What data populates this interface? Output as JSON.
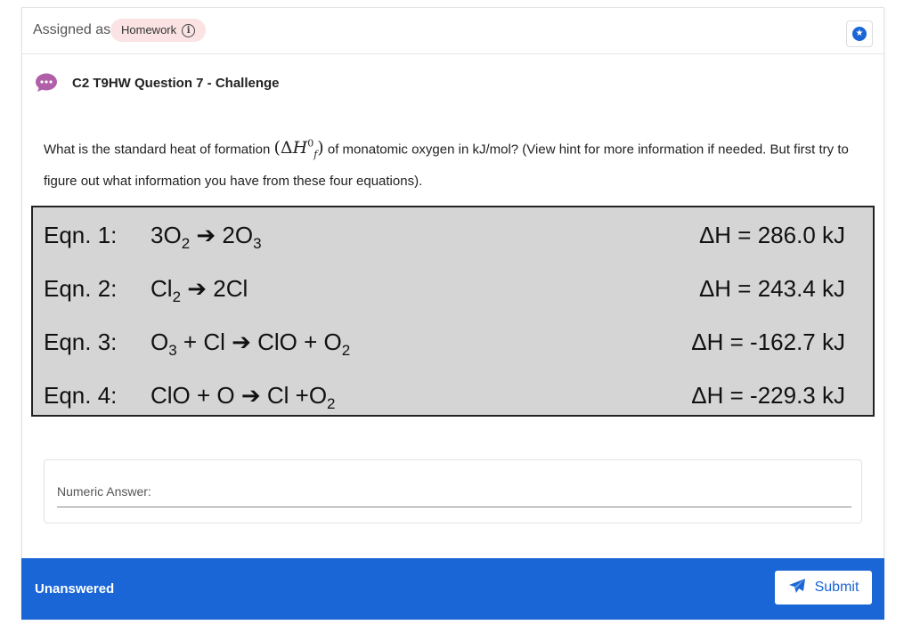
{
  "header": {
    "assigned_label": "Assigned as",
    "badge_label": "Homework"
  },
  "question": {
    "title": "C2 T9HW Question 7 - Challenge",
    "text_before": "What is the standard heat of formation",
    "text_after": "of monatomic oxygen in kJ/mol? (View hint for more information if needed. But first try to figure out what information you have from these four equations)."
  },
  "equations": [
    {
      "label": "Eqn. 1:",
      "dh": "ΔH = 286.0 kJ"
    },
    {
      "label": "Eqn. 2:",
      "dh": "ΔH = 243.4 kJ"
    },
    {
      "label": "Eqn. 3:",
      "dh": "ΔH = -162.7 kJ"
    },
    {
      "label": "Eqn. 4:",
      "dh": "ΔH = -229.3 kJ"
    }
  ],
  "answer": {
    "label": "Numeric Answer:"
  },
  "footer": {
    "status": "Unanswered",
    "submit_label": "Submit"
  },
  "colors": {
    "primary": "#1a66d6",
    "badge_bg": "#fbe3e3",
    "chat_icon": "#b05fa8",
    "equation_bg": "#d5d5d5"
  }
}
